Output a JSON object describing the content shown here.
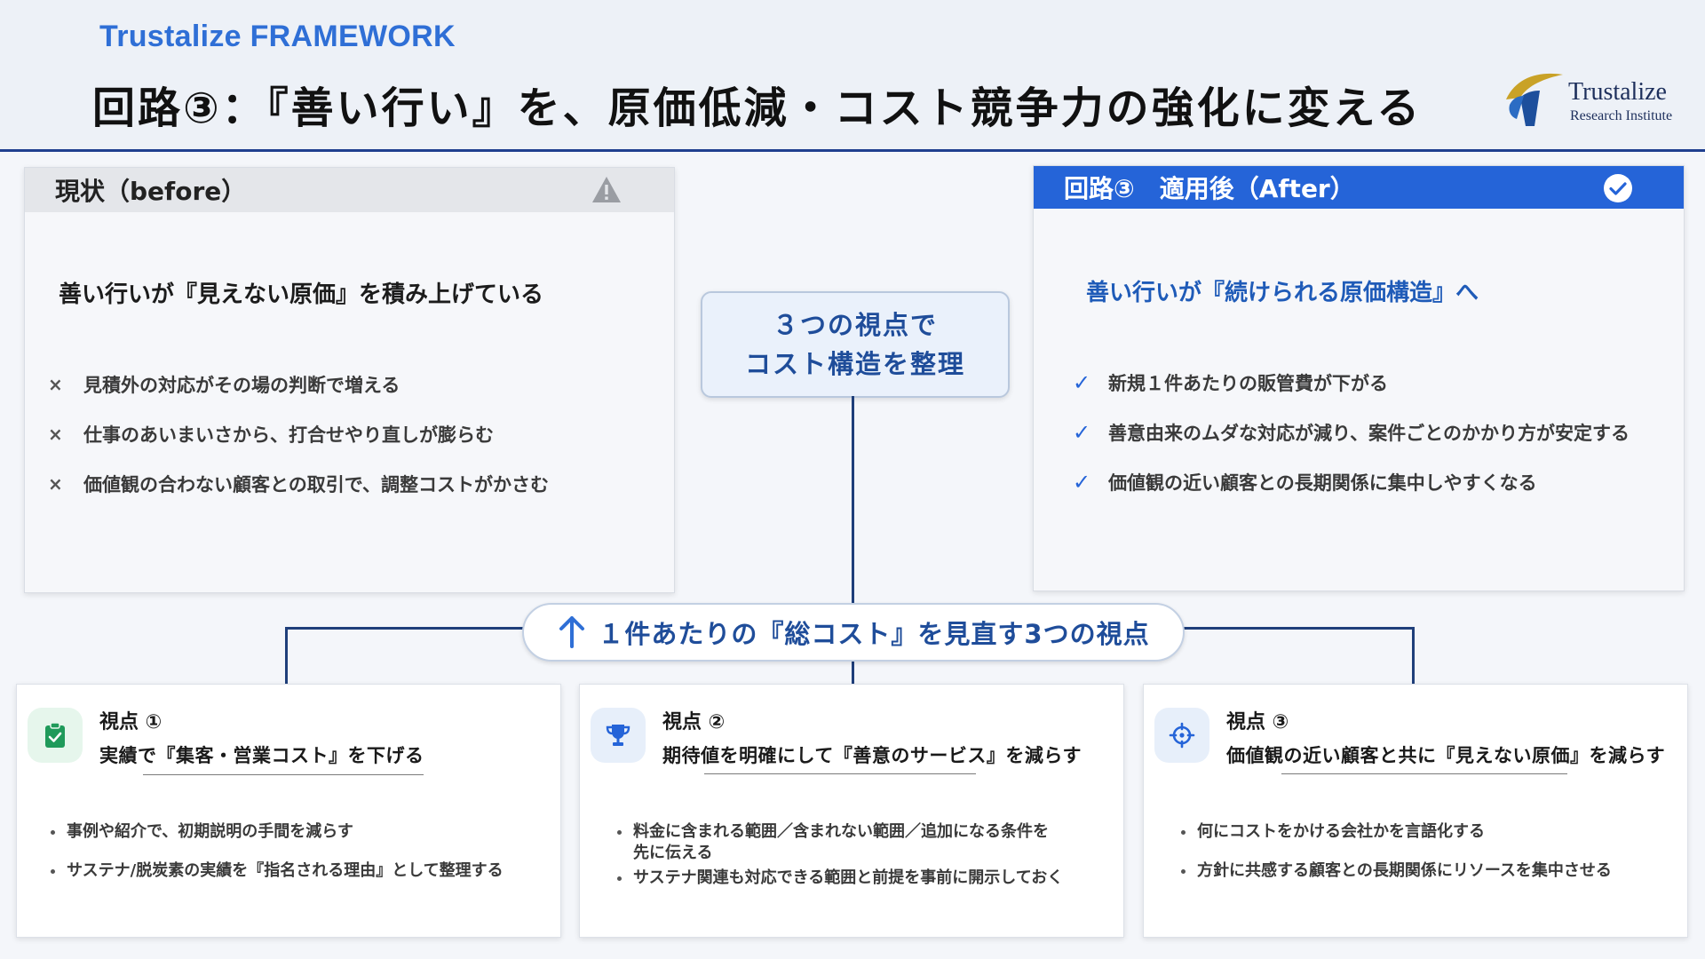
{
  "header": {
    "brand_tag": "Trustalize FRAMEWORK",
    "title": "回路③：『善い行い』を、原価低減・コスト競争力の強化に変える",
    "logo": {
      "name": "Trustalize",
      "sub": "Research Institute"
    }
  },
  "before": {
    "heading": "現状（before）",
    "icon": "warning-icon",
    "subtitle": "善い行いが『見えない原価』を積み上げている",
    "items": [
      "見積外の対応がその場の判断で増える",
      "仕事のあいまいさから、打合せやり直しが膨らむ",
      "価値観の合わない顧客との取引で、調整コストがかさむ"
    ]
  },
  "after": {
    "heading": "回路③　適用後（After）",
    "icon": "check-circle-icon",
    "subtitle": "善い行いが『続けられる原価構造』へ",
    "items": [
      "新規１件あたりの販管費が下がる",
      "善意由来のムダな対応が減り、案件ごとのかかり方が安定する",
      "価値観の近い顧客との長期関係に集中しやすくなる"
    ]
  },
  "hub": {
    "line1": "３つの視点で",
    "line2": "コスト構造を整理"
  },
  "banner": {
    "text": "１件あたりの『総コスト』を見直す3つの視点",
    "icon": "arrow-up-icon"
  },
  "cards": [
    {
      "label": "視点 ①",
      "title": "実績で『集客・営業コスト』を下げる",
      "icon": "clipboard-check-icon",
      "bullets": [
        "事例や紹介で、初期説明の手間を減らす",
        "サステナ/脱炭素の実績を『指名される理由』として整理する"
      ]
    },
    {
      "label": "視点 ②",
      "title": "期待値を明確にして『善意のサービス』を減らす",
      "icon": "trophy-icon",
      "bullets": [
        "料金に含まれる範囲／含まれない範囲／追加になる条件を\n先に伝える",
        "サステナ関連も対応できる範囲と前提を事前に開示しておく"
      ]
    },
    {
      "label": "視点 ③",
      "title": "価値観の近い顧客と共に『見えない原価』を減らす",
      "icon": "crosshair-icon",
      "bullets": [
        "何にコストをかける会社かを言語化する",
        "方針に共感する顧客との長期関係にリソースを集中させる"
      ]
    }
  ],
  "colors": {
    "accent": "#2564d8",
    "navy": "#1f3f7a",
    "brand": "#2f6fd6",
    "green": "#1f9a5a"
  }
}
